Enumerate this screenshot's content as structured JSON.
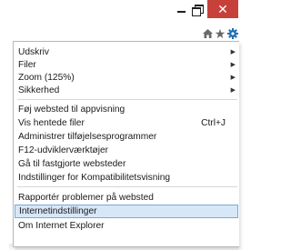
{
  "window": {
    "close_glyph": "✕",
    "star_glyph": "★",
    "accent_close": "#c7413a",
    "gear_color": "#1f6fb2"
  },
  "menu": {
    "items": [
      {
        "label": "Udskriv",
        "shortcut": "",
        "submenu": true
      },
      {
        "label": "Filer",
        "shortcut": "",
        "submenu": true
      },
      {
        "label": "Zoom (125%)",
        "shortcut": "",
        "submenu": true
      },
      {
        "label": "Sikkerhed",
        "shortcut": "",
        "submenu": true
      },
      {
        "label": "Føj websted til appvisning",
        "shortcut": "",
        "submenu": false
      },
      {
        "label": "Vis hentede filer",
        "shortcut": "Ctrl+J",
        "submenu": false
      },
      {
        "label": "Administrer tilføjelsesprogrammer",
        "shortcut": "",
        "submenu": false
      },
      {
        "label": "F12-udviklerværktøjer",
        "shortcut": "",
        "submenu": false
      },
      {
        "label": "Gå til fastgjorte websteder",
        "shortcut": "",
        "submenu": false
      },
      {
        "label": "Indstillinger for Kompatibilitetsvisning",
        "shortcut": "",
        "submenu": false
      },
      {
        "label": "Rapportér problemer på websted",
        "shortcut": "",
        "submenu": false
      },
      {
        "label": "Internetindstillinger",
        "shortcut": "",
        "submenu": false,
        "highlighted": true
      },
      {
        "label": "Om Internet Explorer",
        "shortcut": "",
        "submenu": false
      }
    ],
    "arrow_glyph": "▶"
  }
}
